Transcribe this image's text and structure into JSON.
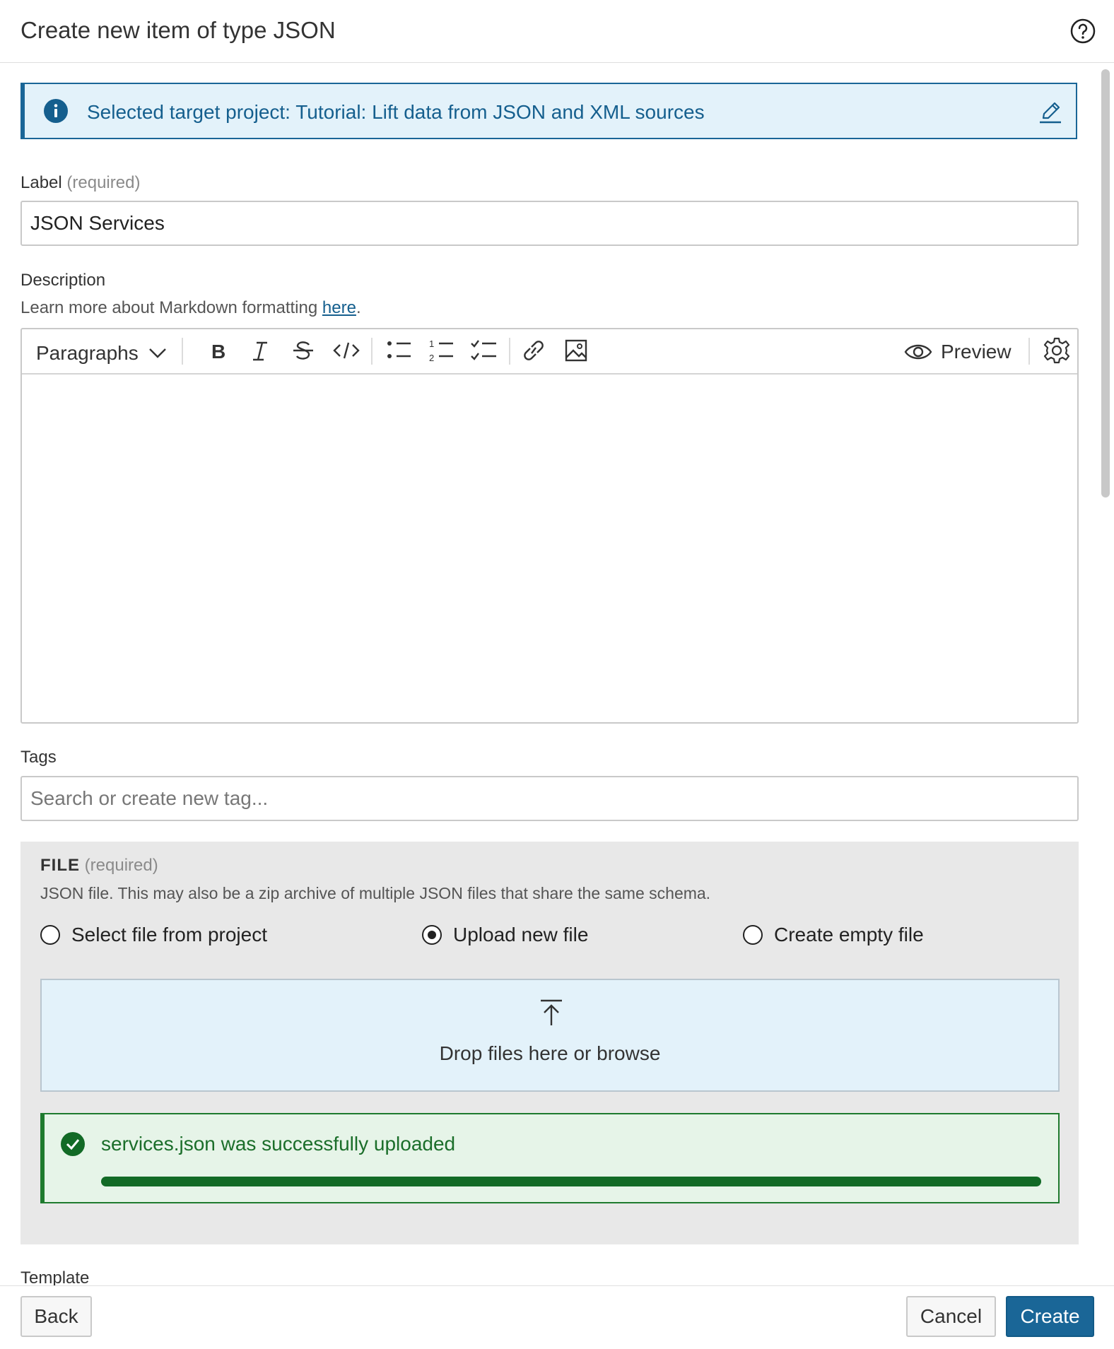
{
  "header": {
    "title": "Create new item of type JSON"
  },
  "banner": {
    "text": "Selected target project: Tutorial: Lift data from JSON and XML sources"
  },
  "label_field": {
    "label": "Label",
    "required": "(required)",
    "value": "JSON Services"
  },
  "description": {
    "label": "Description",
    "hint_prefix": "Learn more about Markdown formatting ",
    "hint_link": "here",
    "hint_suffix": ".",
    "toolbar": {
      "paragraphs": "Paragraphs",
      "preview": "Preview"
    }
  },
  "tags": {
    "label": "Tags",
    "placeholder": "Search or create new tag..."
  },
  "file": {
    "title": "FILE",
    "required": "(required)",
    "description": "JSON file. This may also be a zip archive of multiple JSON files that share the same schema.",
    "options": [
      "Select file from project",
      "Upload new file",
      "Create empty file"
    ],
    "selected": "Upload new file",
    "dropzone_text": "Drop files here or browse",
    "upload_message": "services.json was successfully uploaded",
    "upload_progress": 1.0
  },
  "template": {
    "label": "Template"
  },
  "footer": {
    "back": "Back",
    "cancel": "Cancel",
    "create": "Create"
  },
  "colors": {
    "accent": "#1a6697",
    "success": "#126a26",
    "info_bg": "#e3f2fa"
  }
}
